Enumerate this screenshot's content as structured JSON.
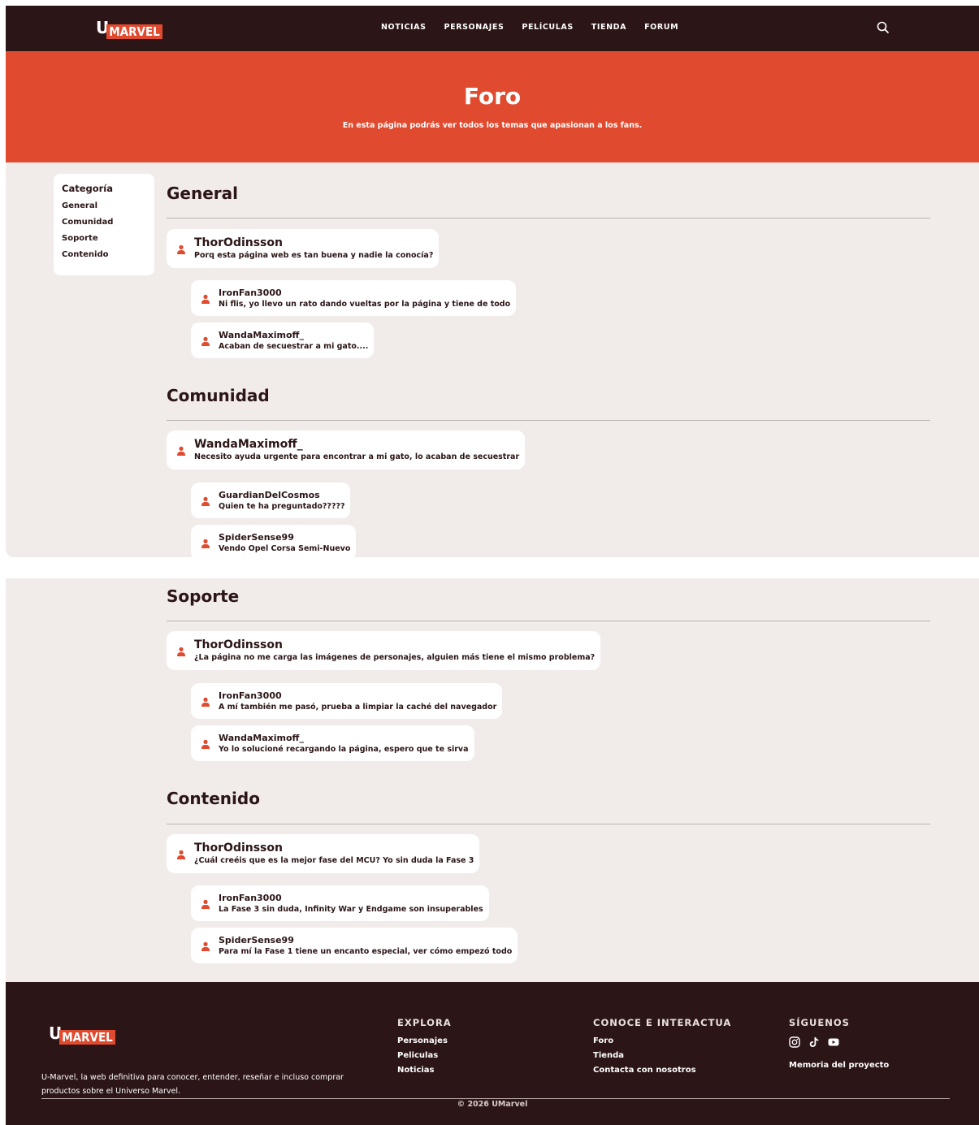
{
  "brand": {
    "logo_u": "U",
    "logo_marvel": "MARVEL"
  },
  "nav": {
    "items": [
      "NOTICIAS",
      "PERSONAJES",
      "PELÍCULAS",
      "TIENDA",
      "FORUM"
    ]
  },
  "hero": {
    "title": "Foro",
    "subtitle": "En esta página podrás ver todos los temas que apasionan a los fans."
  },
  "sidebar": {
    "title": "Categoría",
    "items": [
      "General",
      "Comunidad",
      "Soporte",
      "Contenido"
    ]
  },
  "sections": {
    "general": {
      "title": "General",
      "main": {
        "user": "ThorOdinsson",
        "text": "Porq esta página web es tan buena y nadie la conocía?"
      },
      "replies": [
        {
          "user": "IronFan3000",
          "text": "Ni flis, yo llevo un rato dando vueltas por la página y tiene de todo"
        },
        {
          "user": "WandaMaximoff_",
          "text": "Acaban de secuestrar a mi gato...."
        }
      ]
    },
    "comunidad": {
      "title": "Comunidad",
      "main": {
        "user": "WandaMaximoff_",
        "text": "Necesito ayuda urgente para encontrar a mi gato, lo acaban de secuestrar"
      },
      "replies": [
        {
          "user": "GuardianDelCosmos",
          "text": "Quien te ha preguntado?????"
        },
        {
          "user": "SpiderSense99",
          "text": "Vendo Opel Corsa Semi-Nuevo"
        }
      ]
    },
    "soporte": {
      "title": "Soporte",
      "main": {
        "user": "ThorOdinsson",
        "text": "¿La página no me carga las imágenes de personajes, alguien más tiene el mismo problema?"
      },
      "replies": [
        {
          "user": "IronFan3000",
          "text": "A mí también me pasó, prueba a limpiar la caché del navegador"
        },
        {
          "user": "WandaMaximoff_",
          "text": "Yo lo solucioné recargando la página, espero que te sirva"
        }
      ]
    },
    "contenido": {
      "title": "Contenido",
      "main": {
        "user": "ThorOdinsson",
        "text": "¿Cuál creéis que es la mejor fase del MCU? Yo sin duda la Fase 3"
      },
      "replies": [
        {
          "user": "IronFan3000",
          "text": "La Fase 3 sin duda, Infinity War y Endgame son insuperables"
        },
        {
          "user": "SpiderSense99",
          "text": "Para mí la Fase 1 tiene un encanto especial, ver cómo empezó todo"
        }
      ]
    }
  },
  "footer": {
    "description": "U-Marvel, la web definitiva para conocer, entender, reseñar e incluso comprar productos sobre el Universo Marvel.",
    "explora": {
      "title": "EXPLORA",
      "links": [
        "Personajes",
        "Peliculas",
        "Noticias"
      ]
    },
    "conoce": {
      "title": "CONOCE E INTERACTUA",
      "links": [
        "Foro",
        "Tienda",
        "Contacta con nosotros"
      ]
    },
    "siguenos": {
      "title": "SÍGUENOS",
      "icons": [
        "instagram-icon",
        "tiktok-icon",
        "youtube-icon"
      ],
      "link": "Memoria del proyecto"
    },
    "copyright": "© 2026 UMarvel"
  },
  "colors": {
    "header_bg": "#2c1517",
    "accent": "#e04a2f",
    "page_bg": "#f1ecea"
  }
}
